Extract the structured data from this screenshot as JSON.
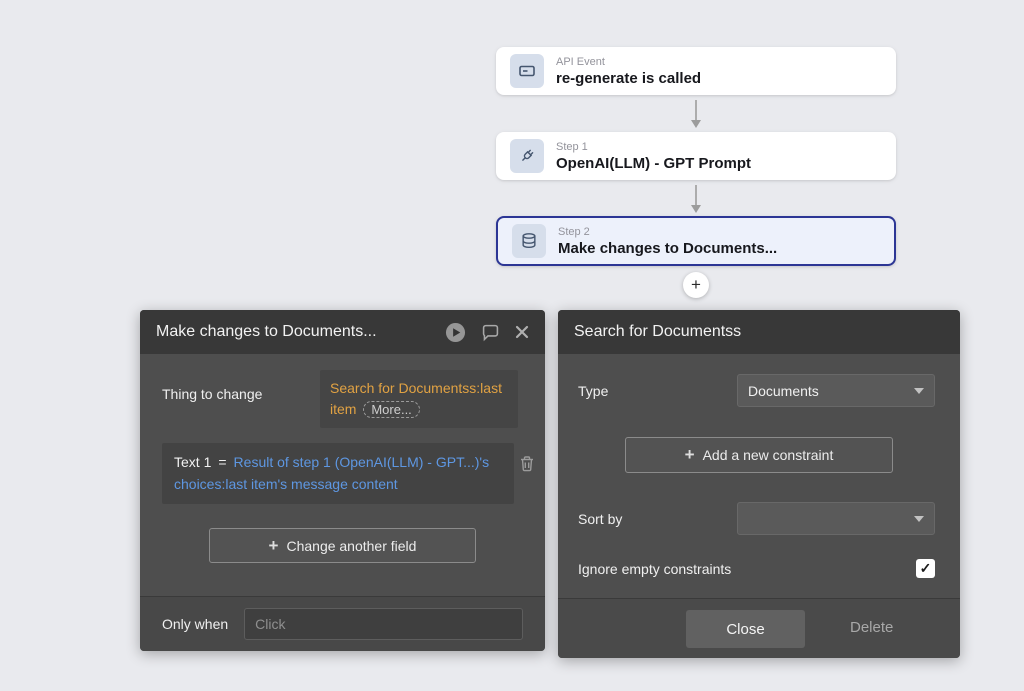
{
  "ui": {
    "plus": "+",
    "check": "✓"
  },
  "colors": {
    "selected_card_border": "#2c3695",
    "dynamic_expression_orange": "#e1a243",
    "expression_link_blue": "#5e97e2",
    "panel_header": "#383838",
    "panel_body": "#4e4e4e",
    "page_background": "#e9eaee"
  },
  "workflow": {
    "cards": [
      {
        "kind": "API Event",
        "title": "re-generate is called",
        "icon": "api-event-icon",
        "selected": false
      },
      {
        "kind": "Step 1",
        "title": "OpenAI(LLM) - GPT Prompt",
        "icon": "plugin-icon",
        "selected": false
      },
      {
        "kind": "Step 2",
        "title": "Make changes to Documents...",
        "icon": "database-icon",
        "selected": true
      }
    ]
  },
  "action_panel": {
    "title": "Make changes to Documents...",
    "thing_to_change_label": "Thing to change",
    "thing_to_change_value": "Search for Documentss:last item",
    "more_label": "More...",
    "field_name": "Text 1",
    "field_operator": "=",
    "field_value": "Result of step 1 (OpenAI(LLM) - GPT...)'s choices:last item's message content",
    "change_field_button": "Change another field",
    "only_when_label": "Only when",
    "only_when_placeholder": "Click"
  },
  "search_panel": {
    "title": "Search for Documentss",
    "type_label": "Type",
    "type_value": "Documents",
    "add_constraint_button": "Add a new constraint",
    "sort_by_label": "Sort by",
    "sort_by_value": "",
    "ignore_label": "Ignore empty constraints",
    "ignore_checked": true,
    "close_button": "Close",
    "delete_button": "Delete"
  }
}
